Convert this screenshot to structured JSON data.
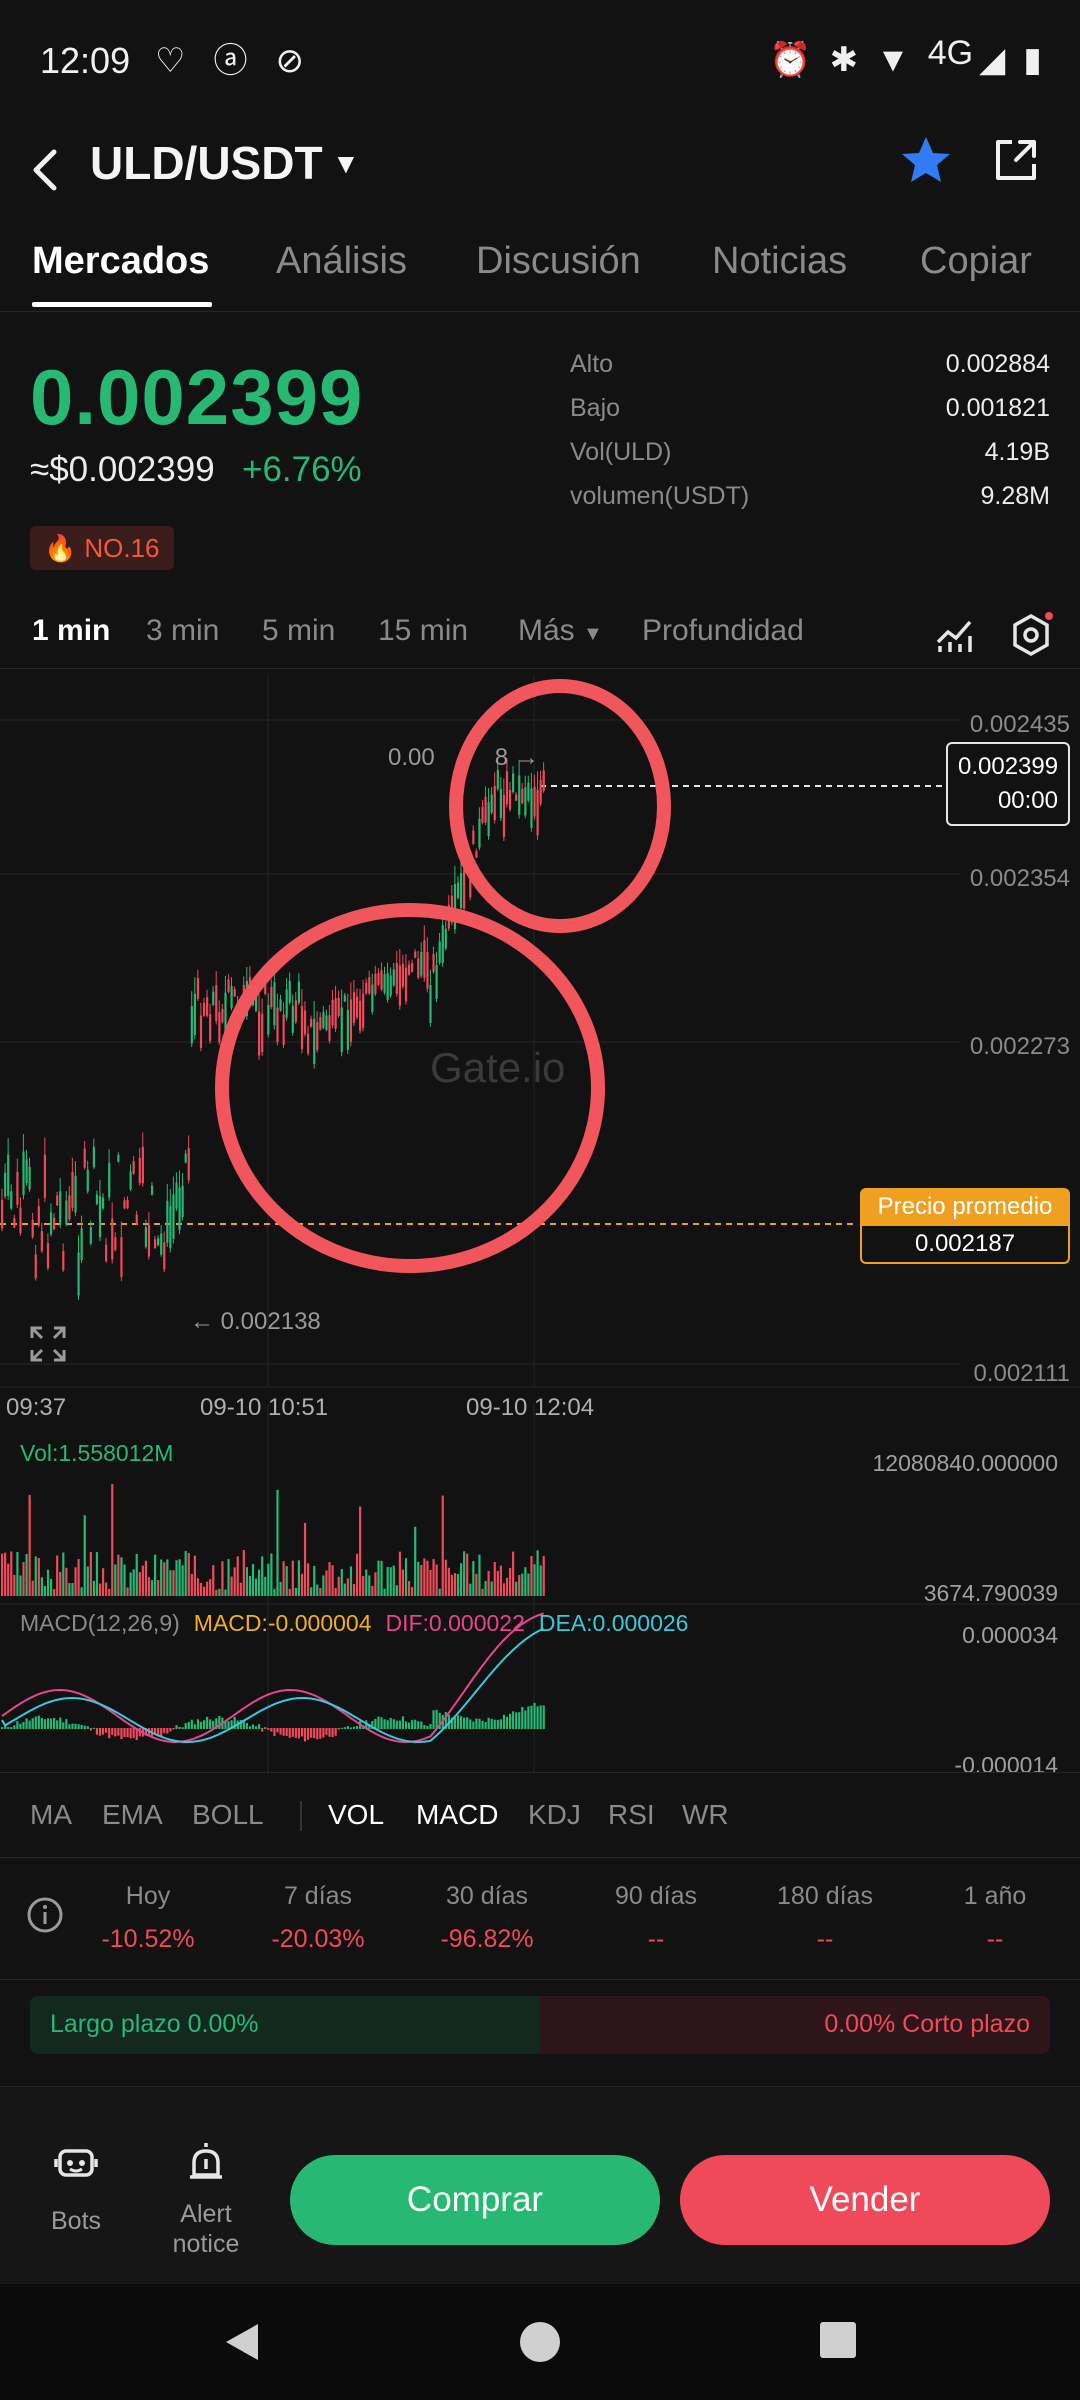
{
  "status_bar": {
    "time": "12:09",
    "network": "4G"
  },
  "header": {
    "pair": "ULD/USDT",
    "caret": "▼"
  },
  "tabs": [
    "Mercados",
    "Análisis",
    "Discusión",
    "Noticias",
    "Copiar"
  ],
  "price": {
    "last": "0.002399",
    "usd": "≈$0.002399",
    "change": "+6.76%",
    "rank": "NO.16"
  },
  "stats": [
    {
      "k": "Alto",
      "v": "0.002884"
    },
    {
      "k": "Bajo",
      "v": "0.001821"
    },
    {
      "k": "Vol(ULD)",
      "v": "4.19B"
    },
    {
      "k": "volumen(USDT)",
      "v": "9.28M"
    }
  ],
  "intervals": [
    "1 min",
    "3 min",
    "5 min",
    "15 min",
    "Más",
    "Profundidad"
  ],
  "chart": {
    "y_labels": [
      "0.002435",
      "0.002354",
      "0.002273",
      "0.002111"
    ],
    "current_price": "0.002399",
    "countdown": "00:00",
    "avg_label": "Precio promedio",
    "avg_value": "0.002187",
    "high_annot": "0.00",
    "high_annot_end": "8 →",
    "low_annot": "← 0.002138",
    "x_labels": [
      "09:37",
      "09-10 10:51",
      "09-10 12:04"
    ],
    "watermark": "Gate.io",
    "vol_label": "Vol:1.558012M",
    "vol_max": "12080840.000000",
    "vol_min": "3674.790039",
    "macd_name": "MACD(12,26,9)",
    "macd_value": "MACD:-0.000004",
    "dif": "DIF:0.000022",
    "dea": "DEA:0.000026",
    "macd_max": "0.000034",
    "macd_min": "-0.000014",
    "colors": {
      "up": "#27b974",
      "down": "#f04a5a",
      "avg": "#f0a020",
      "annotation": "#f2565d"
    }
  },
  "chart_data": {
    "type": "candlestick",
    "x_range_labels": [
      "09:37",
      "09-10 10:51",
      "09-10 12:04"
    ],
    "ylim": [
      0.002111,
      0.002435
    ],
    "y_ticks": [
      0.002435,
      0.002354,
      0.002273,
      0.002111
    ],
    "last_price": 0.002399,
    "average_price": 0.002187,
    "low_marked": 0.002138,
    "volume_range": [
      3674.790039,
      12080840.0
    ],
    "macd_range": [
      -1.4e-05,
      3.4e-05
    ]
  },
  "indicators": [
    "MA",
    "EMA",
    "BOLL",
    "VOL",
    "MACD",
    "KDJ",
    "RSI",
    "WR"
  ],
  "performance": [
    {
      "label": "Hoy",
      "value": "-10.52%"
    },
    {
      "label": "7 días",
      "value": "-20.03%"
    },
    {
      "label": "30 días",
      "value": "-96.82%"
    },
    {
      "label": "90 días",
      "value": "--"
    },
    {
      "label": "180 días",
      "value": "--"
    },
    {
      "label": "1 año",
      "value": "--"
    }
  ],
  "long_short": {
    "long": "Largo plazo 0.00%",
    "short": "0.00% Corto plazo"
  },
  "actions": {
    "bots": "Bots",
    "alert_line1": "Alert",
    "alert_line2": "notice",
    "buy": "Comprar",
    "sell": "Vender"
  }
}
